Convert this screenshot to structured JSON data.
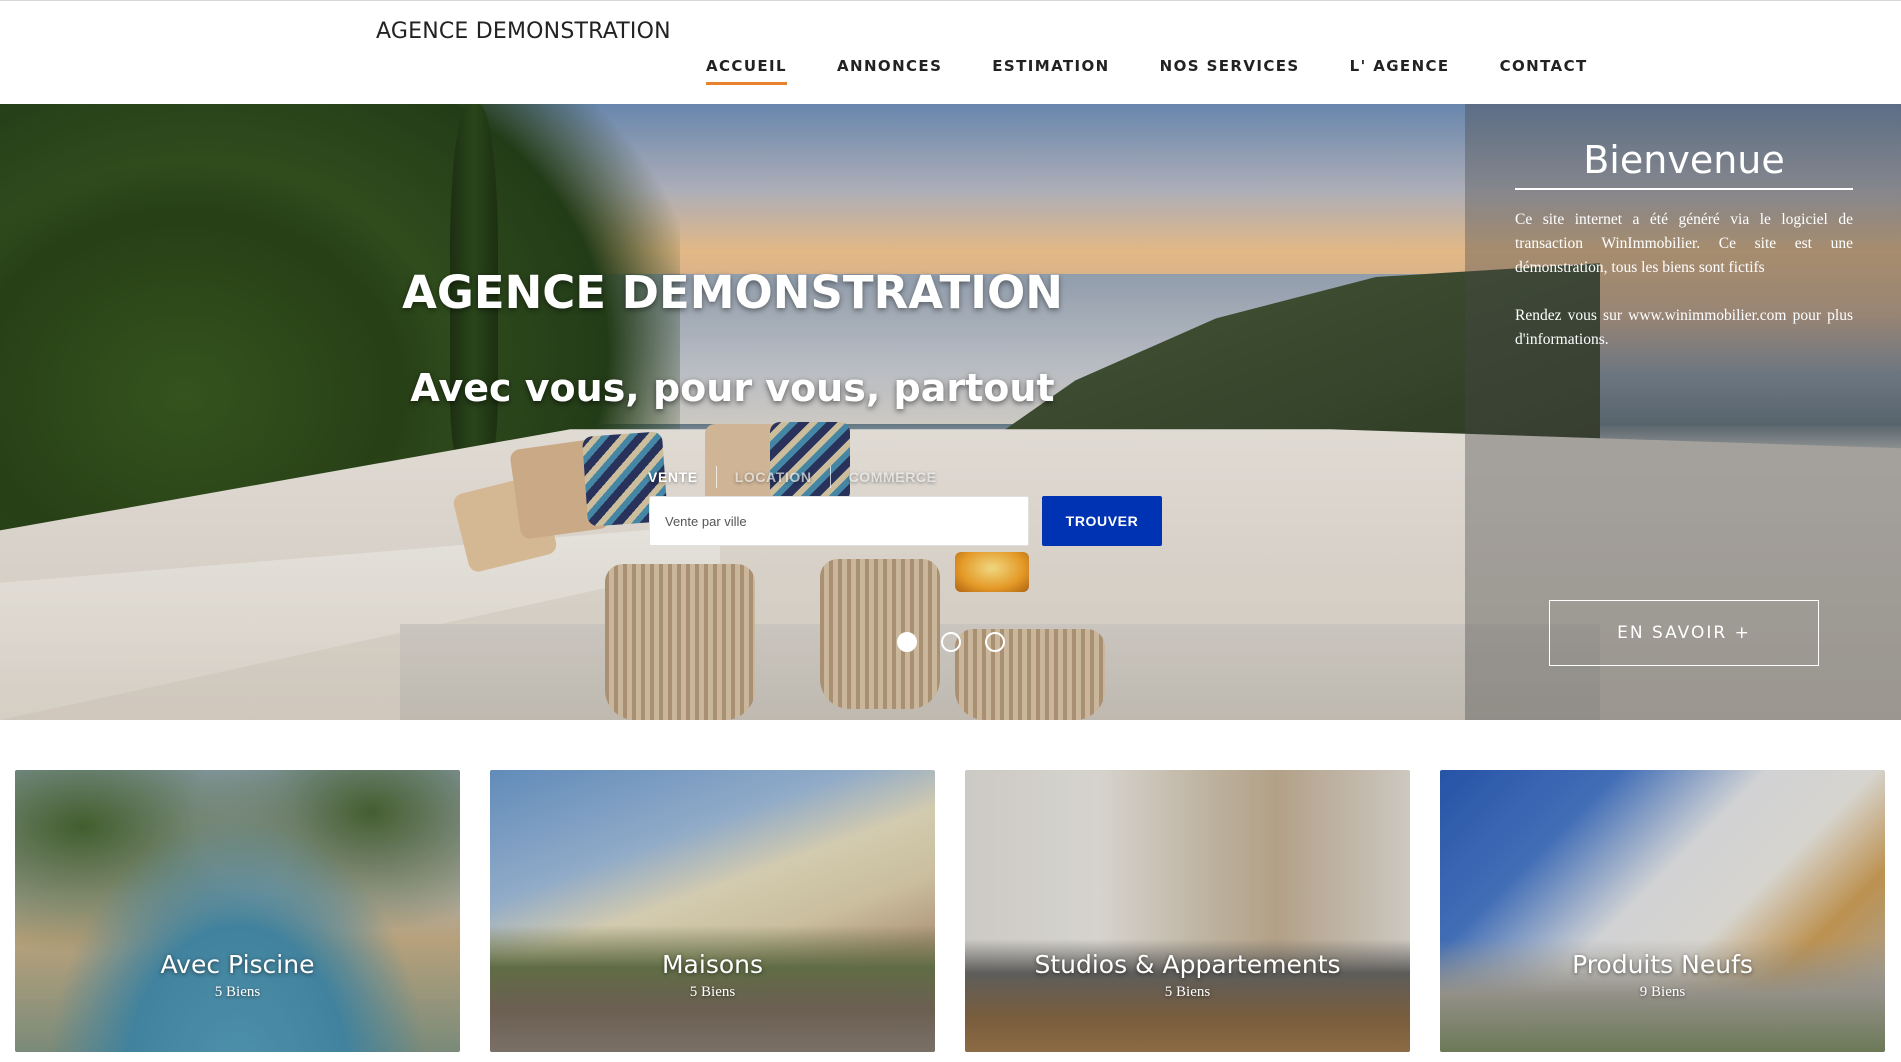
{
  "header": {
    "logo": "AGENCE DEMONSTRATION",
    "nav": [
      {
        "label": "ACCUEIL",
        "active": true
      },
      {
        "label": "ANNONCES"
      },
      {
        "label": "ESTIMATION"
      },
      {
        "label": "NOS SERVICES"
      },
      {
        "label": "L' AGENCE"
      },
      {
        "label": "CONTACT"
      }
    ]
  },
  "hero": {
    "title": "AGENCE DEMONSTRATION",
    "subtitle": "Avec vous, pour vous, partout",
    "tabs": [
      "VENTE",
      "LOCATION",
      "COMMERCE"
    ],
    "search_placeholder": "Vente par ville",
    "search_button": "TROUVER",
    "slides_count": 3,
    "active_slide": 1
  },
  "welcome": {
    "title": "Bienvenue",
    "paragraph1": "Ce site internet a été généré via le logiciel de transaction WinImmobilier. Ce site est une démonstration, tous les biens sont fictifs",
    "paragraph2": "Rendez vous sur www.winimmobilier.com pour plus d'informations.",
    "button": "EN SAVOIR +"
  },
  "categories": [
    {
      "title": "Avec Piscine",
      "count": "5 Biens"
    },
    {
      "title": "Maisons",
      "count": "5 Biens"
    },
    {
      "title": "Studios & Appartements",
      "count": "5 Biens"
    },
    {
      "title": "Produits Neufs",
      "count": "9 Biens"
    }
  ],
  "colors": {
    "accent": "#e8822c",
    "button_primary": "#0032b4"
  }
}
